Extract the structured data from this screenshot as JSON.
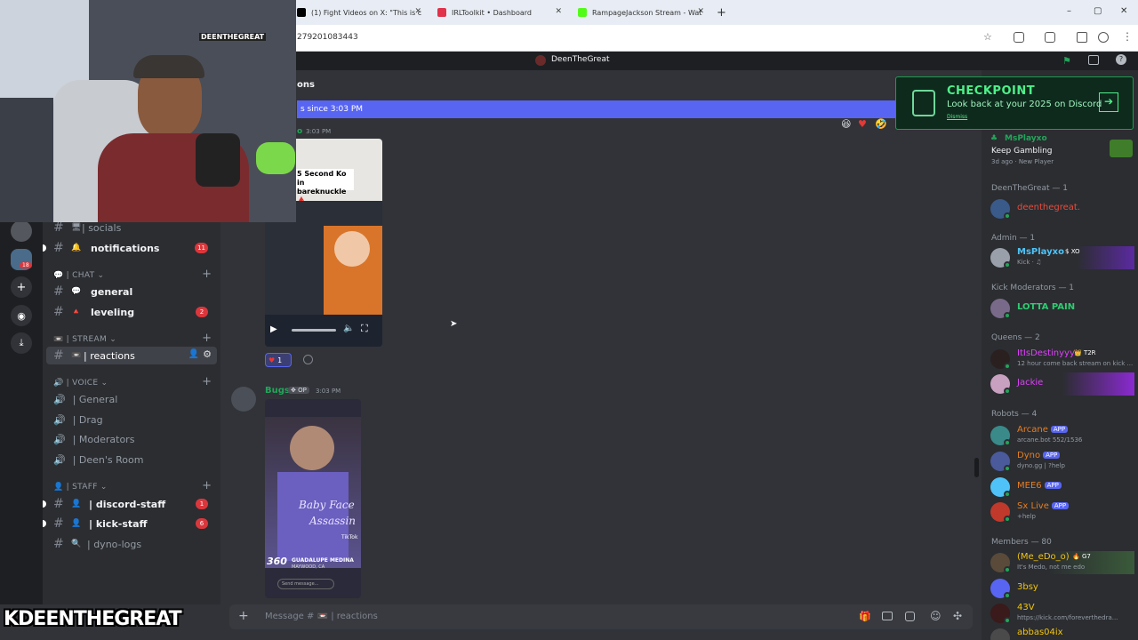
{
  "browser": {
    "tabs": [
      {
        "title": "(1) Fight Videos on X: \"This is c",
        "favicon_color": "#000000"
      },
      {
        "title": "IRLToolkit • Dashboard",
        "favicon_color": "#e0324a"
      },
      {
        "title": "RampageJackson Stream - Wat",
        "favicon_color": "#53fc18"
      }
    ],
    "url_fragment": "279201083443",
    "new_tab_label": "+",
    "window_controls": [
      "–",
      "▢",
      "✕"
    ]
  },
  "discord": {
    "window_title": "DeenTheGreat",
    "channel_header": "ons",
    "new_messages_bar": "s since 3:03 PM",
    "server_badge": "18",
    "categories": {
      "chat": "| CHAT",
      "stream": "| STREAM",
      "voice": "| VOICE",
      "staff": "| STAFF"
    },
    "channels": {
      "socials": {
        "label": "| socials",
        "emoji": "🖥"
      },
      "notifications": {
        "label": "notifications",
        "emoji": "🔔",
        "badge": "11"
      },
      "general": {
        "label": "general",
        "emoji": "💬"
      },
      "leveling": {
        "label": "leveling",
        "emoji": "🔺",
        "badge": "2"
      },
      "reactions": {
        "label": "| reactions",
        "emoji": "📼"
      },
      "discord_staff": {
        "label": "| discord-staff",
        "emoji": "👤",
        "badge": "1"
      },
      "kick_staff": {
        "label": "| kick-staff",
        "emoji": "👤",
        "badge": "6"
      },
      "dyno_logs": {
        "label": "| dyno-logs",
        "emoji": "🔍"
      }
    },
    "voice_channels": [
      "| General",
      "| Drag",
      "| Moderators",
      "| Deen's Room"
    ],
    "messages": [
      {
        "author_fragment": "o",
        "time": "3:03 PM",
        "video_caption": "5 Second Ko in bareknuckle 🩸",
        "reaction_count": "1"
      },
      {
        "author": "Bugs",
        "tag": "OP",
        "time": "3:03 PM",
        "video_text_1": "Baby Face",
        "video_text_2": "Assassin",
        "video_subtitle": "GUADALUPE MEDINA",
        "video_location": "MAYWOOD, CA",
        "video_brand": "360",
        "tiktok": "TikTok",
        "reply_placeholder": "Send message..."
      }
    ],
    "input_placeholder": "Message # 📼 | reactions",
    "checkpoint": {
      "title": "CHECKPOINT",
      "subtitle": "Look back at your 2025 on Discord",
      "dismiss": "Dismiss"
    },
    "members": {
      "activity": {
        "name": "MsPlayxo",
        "status": "Keep Gambling",
        "meta": "3d ago  ·  New Player"
      },
      "groups": [
        {
          "label": "DeenTheGreat — 1"
        },
        {
          "label": "Admin — 1"
        },
        {
          "label": "Kick Moderators — 1"
        },
        {
          "label": "Queens — 2"
        },
        {
          "label": "Robots — 4"
        },
        {
          "label": "Members — 80"
        }
      ],
      "list": [
        {
          "name": "deenthegreat.",
          "sub": "",
          "color": "#e74c3c"
        },
        {
          "name": "MsPlayxo",
          "tag": "XO",
          "sub": "Kick · ♫",
          "color": "#4fc3f7"
        },
        {
          "name": "LOTTA PAIN",
          "sub": "",
          "color": "#2ecc71"
        },
        {
          "name": "ItIsDestinyyy",
          "tag": "T2R",
          "sub": "12 hour come back stream on kick ...",
          "color": "#e040fb"
        },
        {
          "name": "Jackie",
          "sub": "",
          "color": "#e040fb"
        },
        {
          "name": "Arcane",
          "app": "APP",
          "sub": "arcane.bot 552/1536",
          "color": "#e67e22"
        },
        {
          "name": "Dyno",
          "app": "APP",
          "sub": "dyno.gg | ?help",
          "color": "#e67e22"
        },
        {
          "name": "MEE6",
          "app": "APP",
          "sub": "",
          "color": "#e67e22"
        },
        {
          "name": "Sx Live",
          "app": "APP",
          "sub": "+help",
          "color": "#e67e22"
        },
        {
          "name": "(Me_eDo_o)",
          "tag": "G7",
          "sub": "It's Medo, not me edo",
          "color": "#f1c40f"
        },
        {
          "name": "3bsy",
          "sub": "",
          "color": "#f1c40f"
        },
        {
          "name": "43V",
          "sub": "https://kick.com/foreverthedra...",
          "color": "#f1c40f"
        },
        {
          "name": "abbas04ix",
          "sub": "",
          "color": "#f1c40f"
        }
      ]
    }
  },
  "stream_overlay": {
    "logo_text": "KDEENTHEGREAT",
    "neon_sign": "DEENTHEGREAT"
  },
  "colors": {
    "blurple": "#5865f2",
    "discord_bg": "#313338",
    "sidebar_bg": "#2b2d31",
    "server_bg": "#1e1f22",
    "unread_red": "#da373c",
    "kick_green": "#53fc18"
  }
}
